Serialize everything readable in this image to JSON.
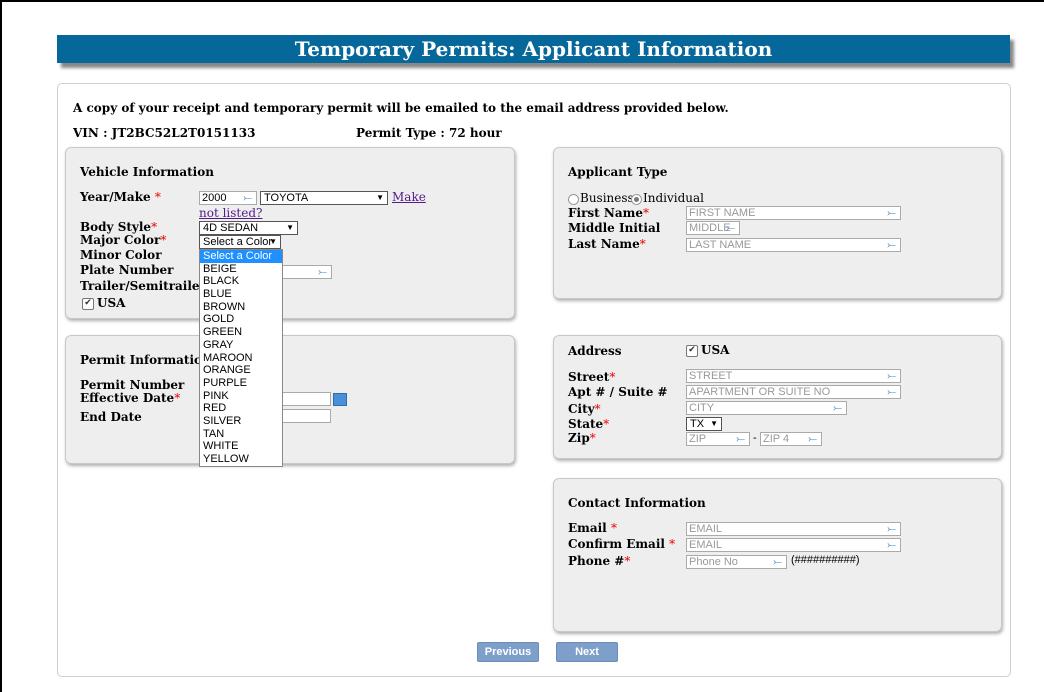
{
  "page": {
    "title": "Temporary Permits: Applicant Information",
    "notice": "A copy of your receipt and temporary permit will be emailed to the email address provided below.",
    "vin": "VIN : JT2BC52L2T0151133",
    "permit_type": "Permit Type : 72 hour"
  },
  "vehicle": {
    "title": "Vehicle Information",
    "year_make_label": "Year/Make",
    "year_value": "2000",
    "make_value": "TOYOTA",
    "make_not_listed": "Make not listed?",
    "make_link_part1": "Make",
    "make_link_part2": "not listed?",
    "body_style_label": "Body Style",
    "body_style_value": "4D SEDAN",
    "major_color_label": "Major Color",
    "major_color_value": "Select a Color",
    "minor_color_label": "Minor Color",
    "plate_number_label": "Plate Number",
    "trailer_label": "Trailer/Semitrailer",
    "usa_label": "USA",
    "color_options": [
      "Select a Color",
      "BEIGE",
      "BLACK",
      "BLUE",
      "BROWN",
      "GOLD",
      "GREEN",
      "GRAY",
      "MAROON",
      "ORANGE",
      "PURPLE",
      "PINK",
      "RED",
      "SILVER",
      "TAN",
      "WHITE",
      "YELLOW"
    ]
  },
  "permit": {
    "title": "Permit Information",
    "permit_number_label": "Permit Number",
    "effective_date_label": "Effective Date",
    "end_date_label": "End Date"
  },
  "applicant": {
    "title": "Applicant Type",
    "business_label": "Business",
    "individual_label": "Individual",
    "first_name_label": "First Name",
    "first_name_placeholder": "FIRST NAME",
    "middle_initial_label": "Middle Initial",
    "middle_placeholder": "MIDDLE",
    "last_name_label": "Last Name",
    "last_name_placeholder": "LAST NAME"
  },
  "address": {
    "title": "Address",
    "usa_label": "USA",
    "street_label": "Street",
    "street_placeholder": "STREET",
    "apt_label": "Apt # / Suite #",
    "apt_placeholder": "APARTMENT OR SUITE NO",
    "city_label": "City",
    "city_placeholder": "CITY",
    "state_label": "State",
    "state_value": "TX",
    "zip_label": "Zip",
    "zip_placeholder": "ZIP",
    "zip4_placeholder": "ZIP 4",
    "zip_sep": "-"
  },
  "contact": {
    "title": "Contact Information",
    "email_label": "Email",
    "email_placeholder": "EMAIL",
    "confirm_email_label": "Confirm Email",
    "confirm_email_placeholder": "EMAIL",
    "phone_label": "Phone #",
    "phone_placeholder": "Phone No",
    "phone_format": "(##########)"
  },
  "buttons": {
    "previous": "Previous",
    "next": "Next"
  },
  "misc": {
    "required_mark": "*",
    "check_mark": "✔"
  }
}
